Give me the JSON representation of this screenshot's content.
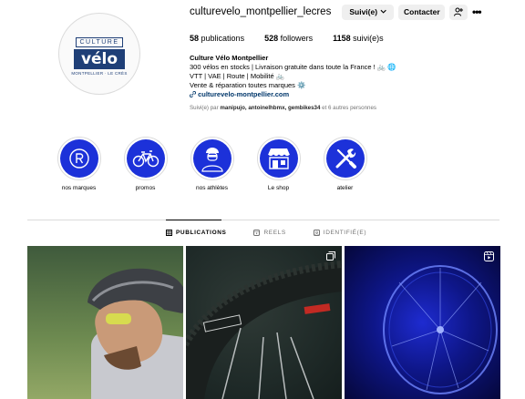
{
  "profile": {
    "username": "culturevelo_montpellier_lecres",
    "follow_button": "Suivi(e)",
    "contact_button": "Contacter",
    "avatar": {
      "culture": "CULTURE",
      "velo": "vélo",
      "sub": "MONTPELLIER · LE CRÈS"
    }
  },
  "stats": {
    "publications_count": "58",
    "publications_label": "publications",
    "followers_count": "528",
    "followers_label": "followers",
    "following_count": "1158",
    "following_label": "suivi(e)s"
  },
  "bio": {
    "name": "Culture Vélo Montpellier",
    "line1": "300 vélos en stocks | Livraison gratuite dans toute la France ! 🚲 🌐",
    "line2": "VTT | VAE | Route | Mobilité 🚲",
    "line3": "Vente & réparation toutes marques ⚙️",
    "link": "culturevelo-montpellier.com"
  },
  "followed_by": {
    "prefix": "Suivi(e) par",
    "names": "manipujo, antoinelhbmx, gembikes34",
    "suffix": "et 6 autres personnes"
  },
  "highlights": [
    {
      "label": "nos marques",
      "icon": "registered-icon"
    },
    {
      "label": "promos",
      "icon": "bicycle-icon"
    },
    {
      "label": "nos athlètes",
      "icon": "cyclist-icon"
    },
    {
      "label": "Le shop",
      "icon": "storefront-icon"
    },
    {
      "label": "atelier",
      "icon": "tools-icon"
    }
  ],
  "tabs": [
    {
      "label": "PUBLICATIONS",
      "active": true
    },
    {
      "label": "REELS",
      "active": false
    },
    {
      "label": "IDENTIFIÉ(E)",
      "active": false
    }
  ],
  "posts": [
    {
      "subject": "cyclist with helmet and yellow glasses",
      "badge": ""
    },
    {
      "subject": "SEVERE tyre close-up",
      "badge": "carousel-icon"
    },
    {
      "subject": "blue lit bicycle wheel",
      "badge": "reel-icon"
    }
  ],
  "colors": {
    "highlight_blue": "#1c31d9",
    "link_blue": "#00376b",
    "logo_blue": "#1f3f77"
  }
}
